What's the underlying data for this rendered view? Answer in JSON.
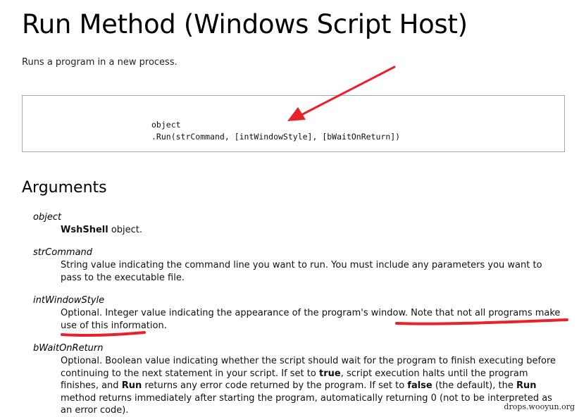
{
  "page": {
    "title": "Run Method (Windows Script Host)",
    "subtitle": "Runs a program in a new process."
  },
  "syntax": {
    "line1": "object",
    "line2": ".Run(strCommand, [intWindowStyle], [bWaitOnReturn])"
  },
  "arguments": {
    "heading": "Arguments",
    "object": {
      "term": "object",
      "bold": "WshShell",
      "rest": " object."
    },
    "strCommand": {
      "term": "strCommand",
      "text": "String value indicating the command line you want to run. You must include any parameters you want to pass to the executable file."
    },
    "intWindowStyle": {
      "term": "intWindowStyle",
      "text": "Optional. Integer value indicating the appearance of the program's window. Note that not all programs make use of this information."
    },
    "bWaitOnReturn": {
      "term": "bWaitOnReturn",
      "part1": "Optional. Boolean value indicating whether the script should wait for the program to finish executing before continuing to the next statement in your script. If set to ",
      "true": "true",
      "part2": ", script execution halts until the program finishes, and ",
      "run1": "Run",
      "part3": " returns any error code returned by the program. If set to ",
      "false": "false",
      "part4": " (the default), the ",
      "run2": "Run",
      "part5": " method returns immediately after starting the program, automatically returning 0 (not to be interpreted as an error code)."
    }
  },
  "watermark": "drops.wooyun.org",
  "annotation": {
    "color": "#e8212b"
  }
}
